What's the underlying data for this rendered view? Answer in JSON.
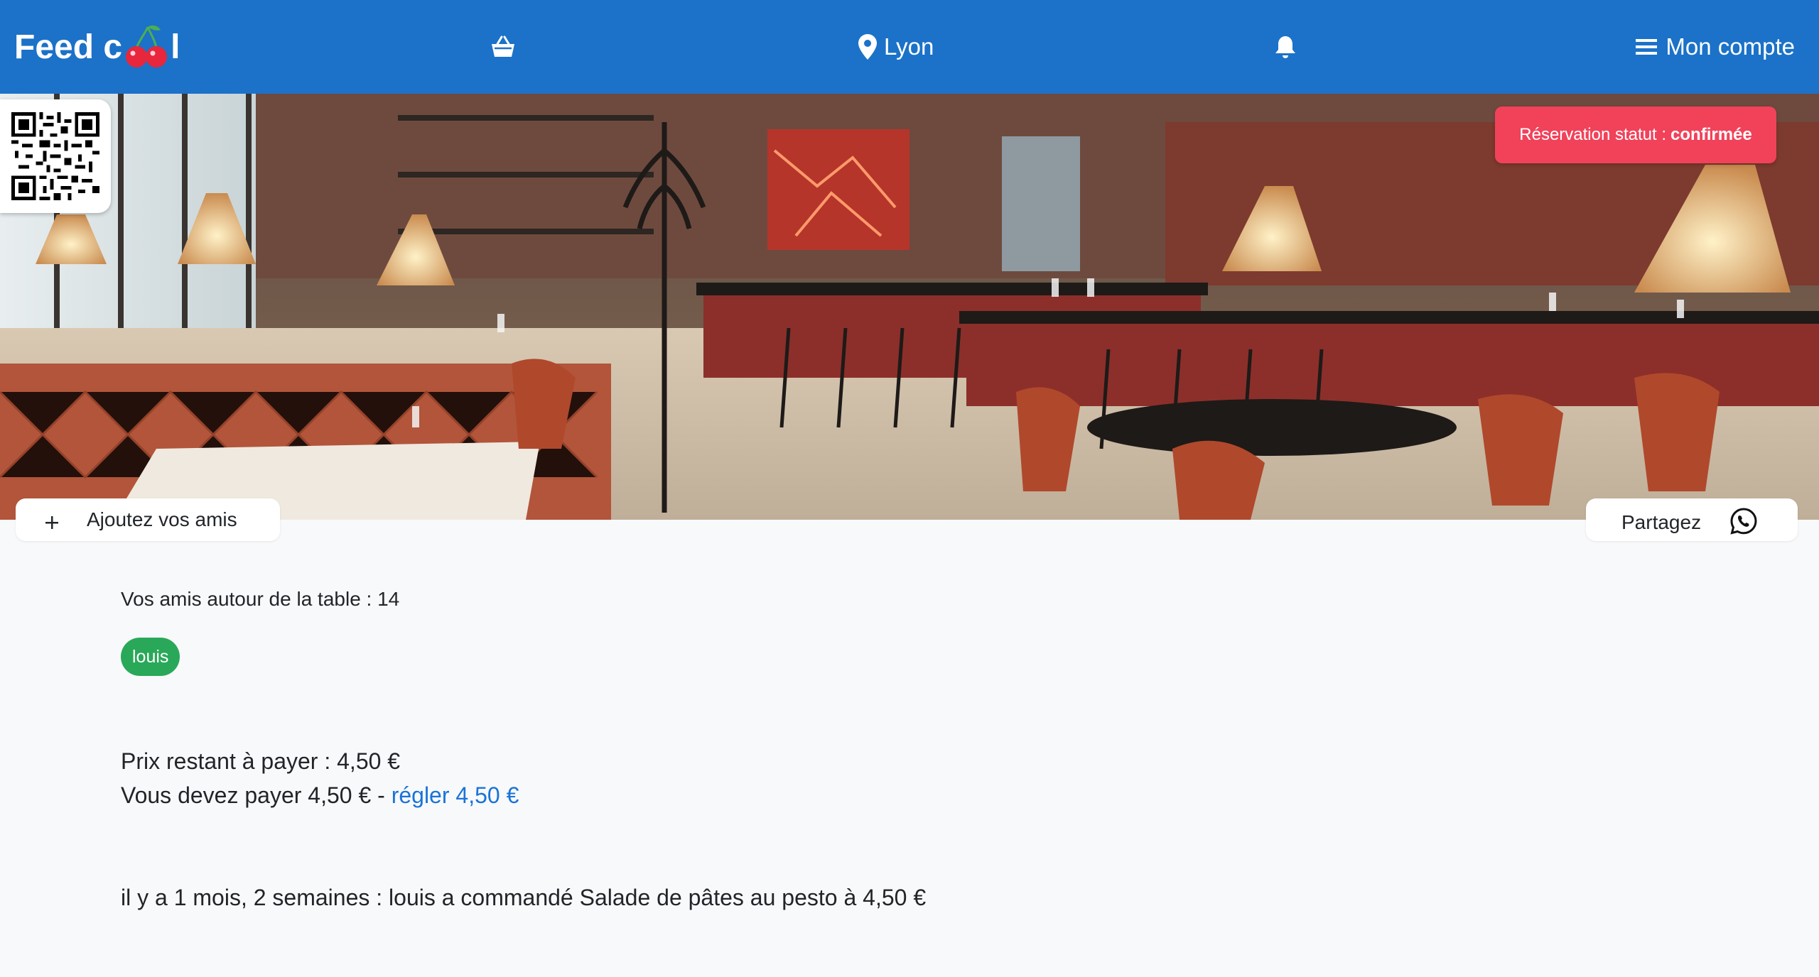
{
  "brand": {
    "name_before": "Feed c",
    "name_after": "l"
  },
  "nav": {
    "city": "Lyon",
    "account": "Mon compte"
  },
  "reservation": {
    "status_label": "Réservation statut :",
    "status_value": "confirmée"
  },
  "actions": {
    "add_friends": "Ajoutez vos amis",
    "share": "Partagez"
  },
  "friends": {
    "count_label": "Vos amis autour de la table : 14",
    "tags": [
      "louis"
    ]
  },
  "payment": {
    "remaining": "Prix restant à payer : 4,50 €",
    "due_text": "Vous devez payer 4,50 € - ",
    "pay_link": "régler 4,50 €"
  },
  "history": {
    "entry": "il y a 1 mois, 2 semaines : louis a commandé Salade de pâtes au pesto à 4,50 €"
  },
  "colors": {
    "navbar": "#1b72c8",
    "status_badge": "#f1425a",
    "friend_tag": "#2aa859",
    "link": "#1a73d9"
  },
  "icons": [
    "cherry-icon",
    "basket-icon",
    "map-pin-icon",
    "bell-icon",
    "menu-icon",
    "qr-code",
    "plus-icon",
    "whatsapp-icon"
  ]
}
